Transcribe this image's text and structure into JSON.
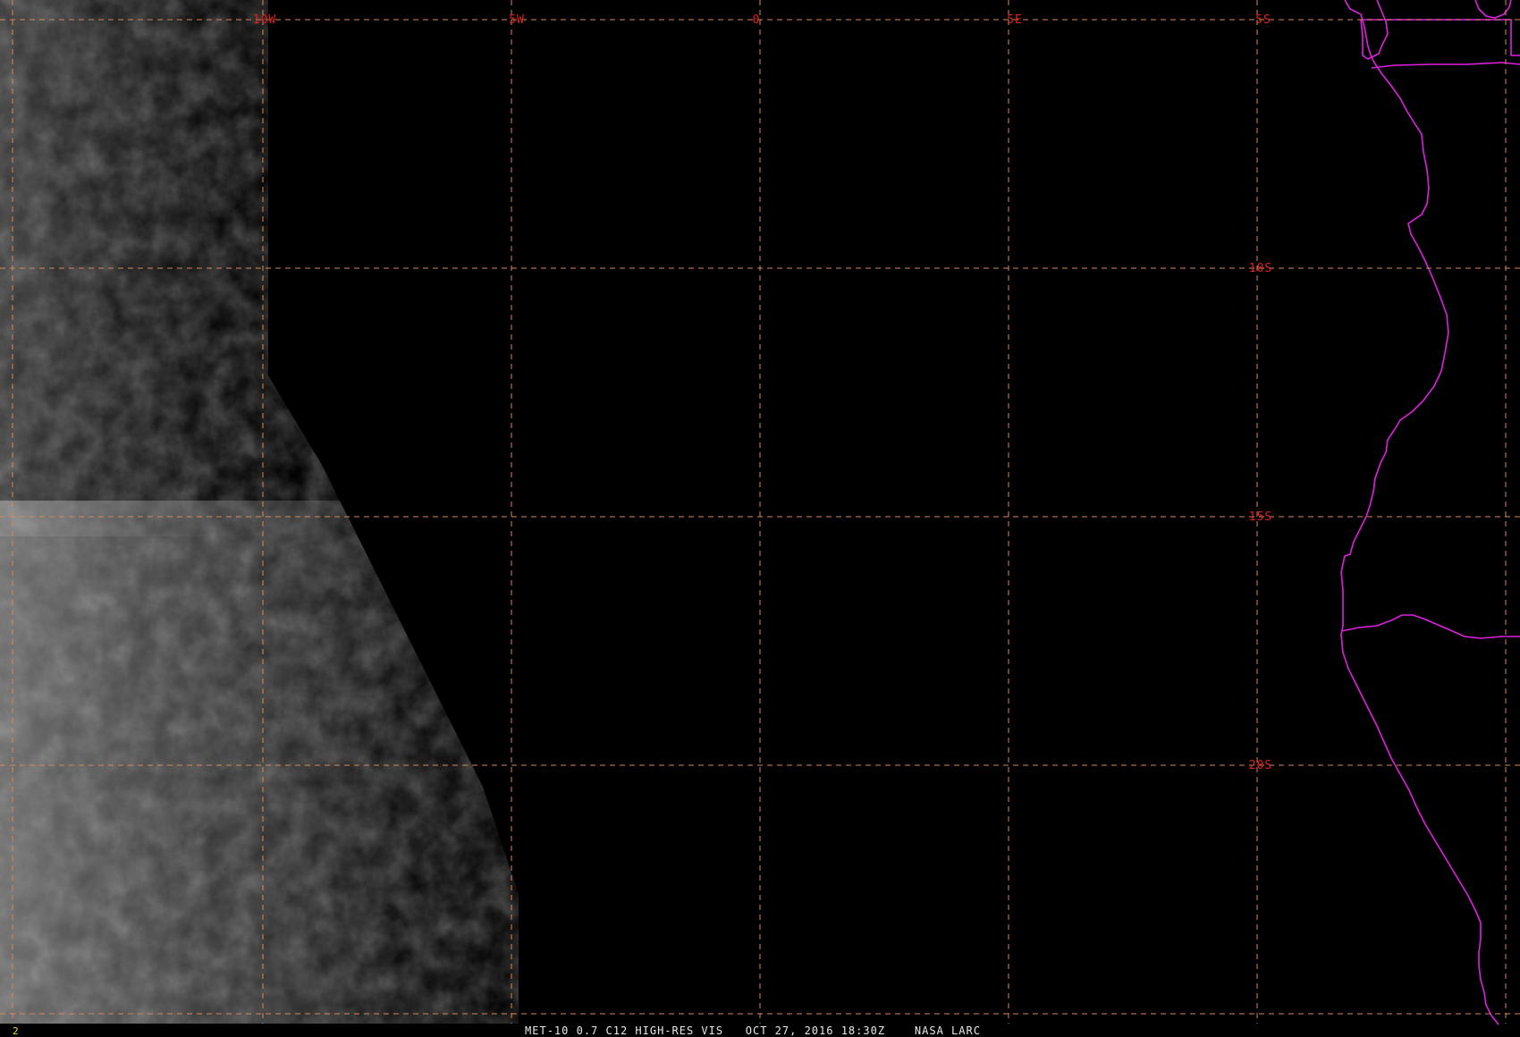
{
  "map": {
    "caption": "MET-10 0.7 C12 HIGH-RES VIS   OCT 27, 2016 18:30Z    NASA LARC",
    "frame_number": "2",
    "longitude_labels": [
      "10W",
      "5W",
      "0",
      "5E"
    ],
    "latitude_labels": [
      "5S",
      "10S",
      "15S",
      "20S"
    ],
    "colors": {
      "background": "#000000",
      "grid": "#d8885a",
      "grid_labels": "#e02020",
      "coastline": "#e020e0",
      "caption": "#e8e8e8",
      "frame_number": "#e0e020"
    }
  }
}
